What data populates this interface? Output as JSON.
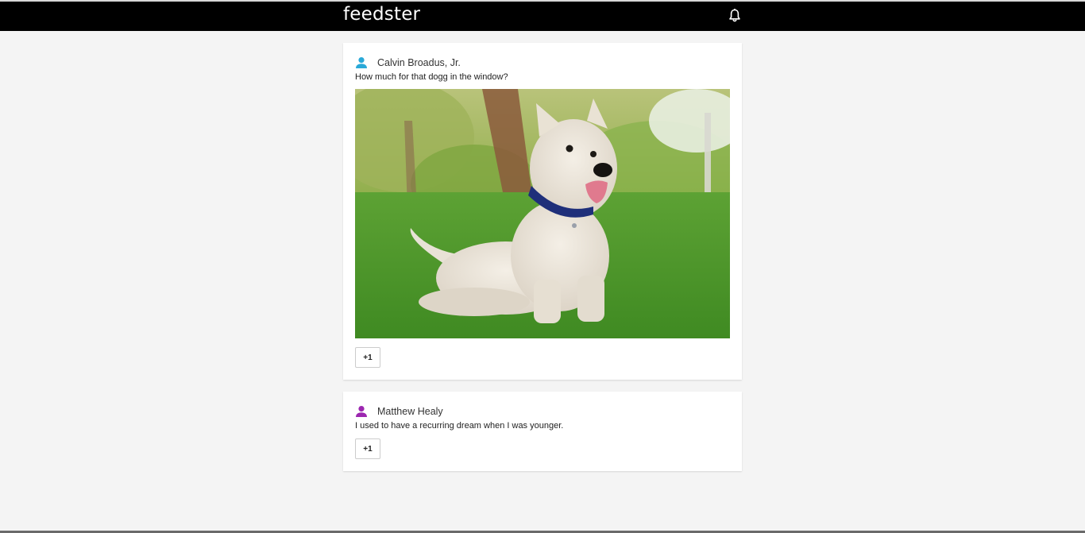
{
  "app": {
    "title": "feedster",
    "notifications_icon": "bell-icon"
  },
  "posts": [
    {
      "author": "Calvin Broadus, Jr.",
      "avatar_icon": "person-icon",
      "avatar_color": "#2aa9d8",
      "text": "How much for that dogg in the window?",
      "has_image": true,
      "image_subject": "dog-photo",
      "plus_label": "+1"
    },
    {
      "author": "Matthew Healy",
      "avatar_icon": "person-icon",
      "avatar_color": "#9c27b0",
      "text": "I used to have a recurring dream when I was younger.",
      "has_image": false,
      "plus_label": "+1"
    }
  ]
}
